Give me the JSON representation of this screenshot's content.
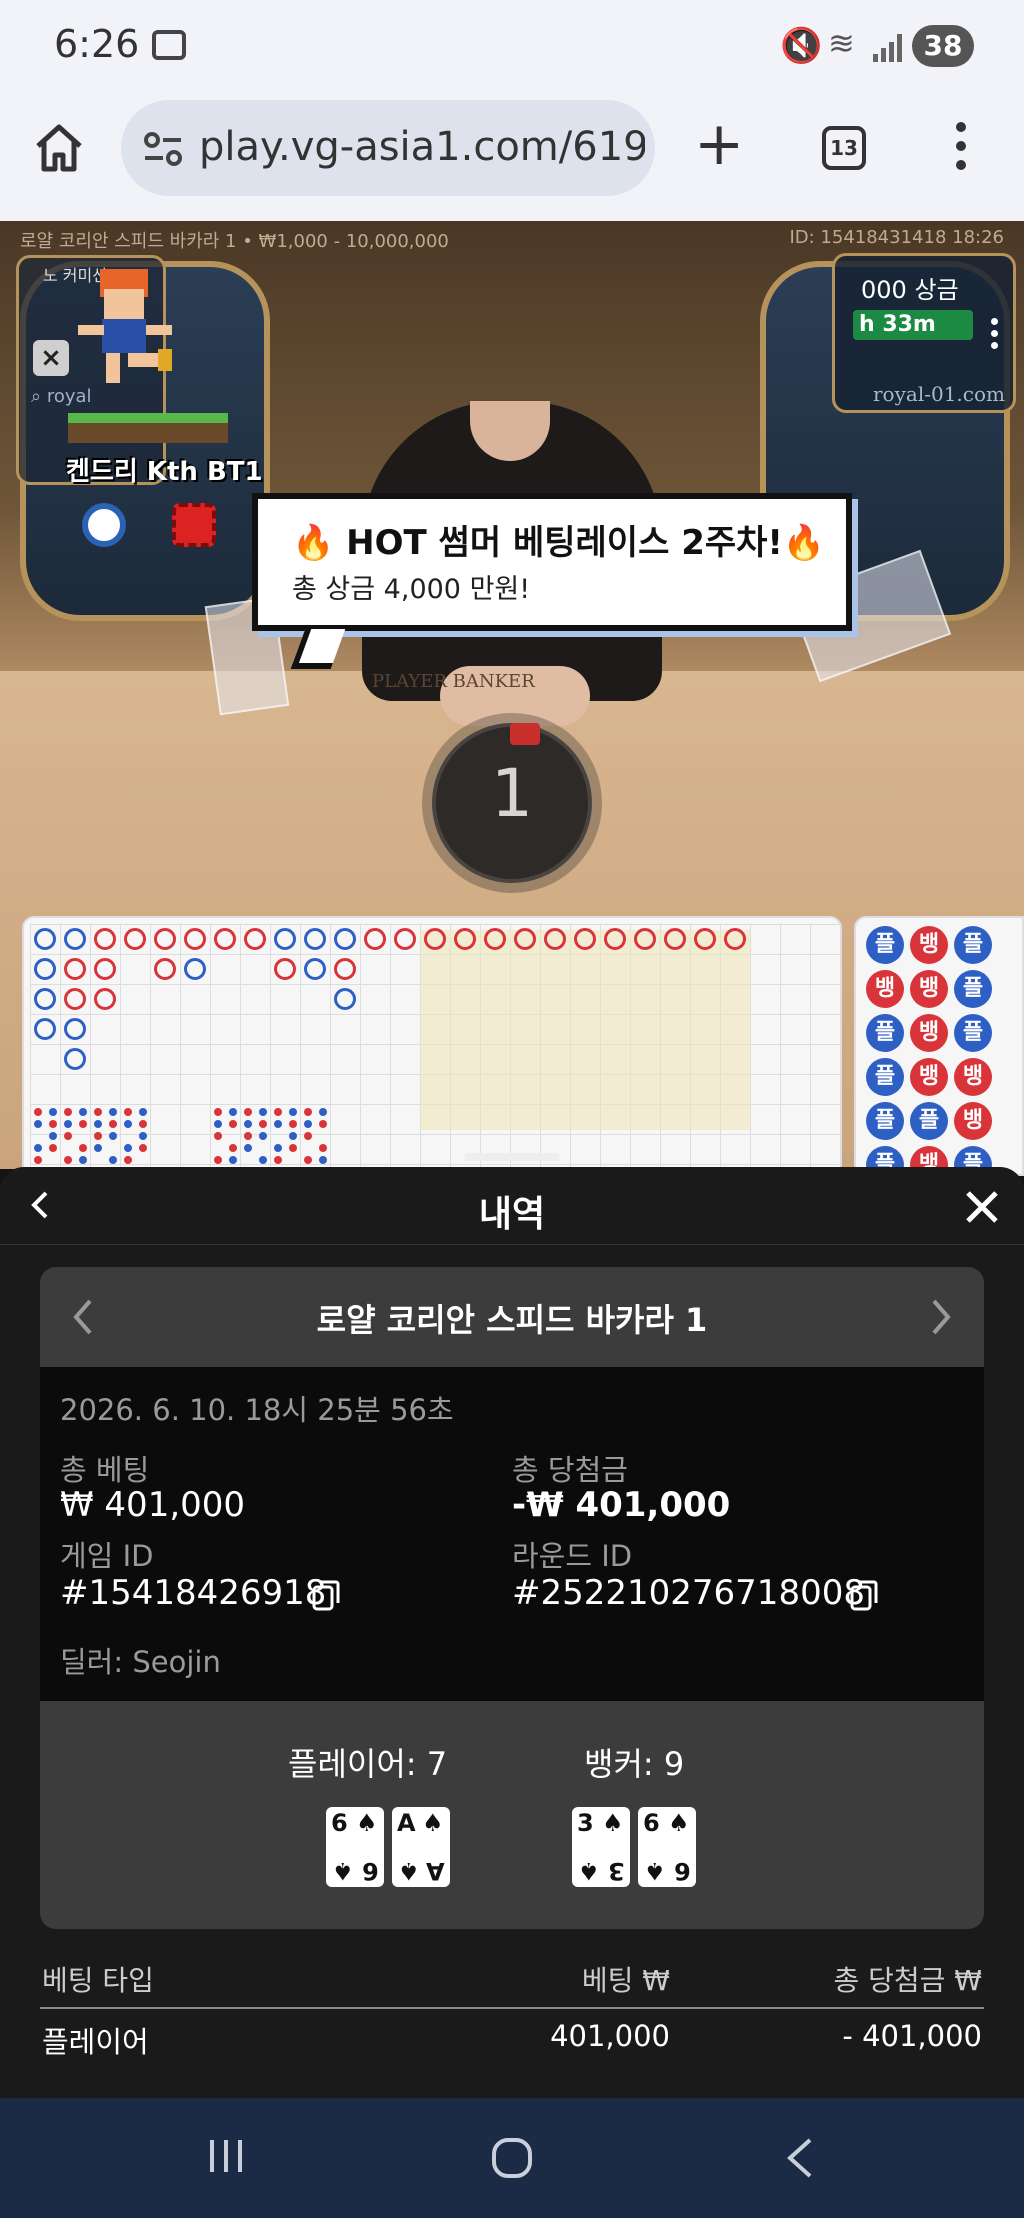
{
  "status_bar": {
    "time": "6:26",
    "battery": "38",
    "icons": [
      "screenshot-icon",
      "mute-icon",
      "wifi-icon",
      "signal-icon",
      "battery-icon"
    ]
  },
  "browser": {
    "url": "play.vg-asia1.com/619",
    "tab_count": "13"
  },
  "game": {
    "top_info": "로얄 코리안 스피드 바카라 1 • ₩1,000 - 10,000,000",
    "game_id_label": "ID: 15418431418 18:26",
    "widget_label": "노 커미션",
    "widget_search": "royal",
    "mascot_name": "켄드리 Kth BT1",
    "right_prize": "000 상금",
    "right_timer": "h 33m",
    "right_site": "royal-01.com",
    "table_text": "PLAYER  BANKER",
    "countdown": "1",
    "promo_title": "🔥 HOT 썸머 베팅레이스 2주차!🔥",
    "promo_sub": "총 상금 4,000 만원!",
    "bead_labels": {
      "player": "플",
      "banker": "뱅"
    }
  },
  "panel": {
    "title": "내역",
    "game_name": "로얄 코리안 스피드 바카라 1",
    "datetime": "2026. 6. 10. 18시 25분 56초",
    "total_bet_label": "총 베팅",
    "total_bet_value": "₩ 401,000",
    "total_win_label": "총 당첨금",
    "total_win_value": "-₩ 401,000",
    "game_id_label": "게임 ID",
    "game_id_value": "#15418426918",
    "round_id_label": "라운드 ID",
    "round_id_value": "#252210276718008",
    "dealer": "딜러: Seojin",
    "player_result": "플레이어: 7",
    "banker_result": "뱅커: 9",
    "player_cards": [
      {
        "rank": "6",
        "suit": "♠"
      },
      {
        "rank": "A",
        "suit": "♠"
      }
    ],
    "banker_cards": [
      {
        "rank": "3",
        "suit": "♠"
      },
      {
        "rank": "6",
        "suit": "♠"
      }
    ],
    "table": {
      "headers": [
        "베팅 타입",
        "베팅 ₩",
        "총 당첨금 ₩"
      ],
      "rows": [
        {
          "type": "플레이어",
          "bet": "401,000",
          "win": "- 401,000"
        }
      ]
    }
  },
  "colors": {
    "player_blue": "#2e5fc4",
    "banker_red": "#d8343a",
    "panel_bg": "#1a1a1a",
    "nav_bg": "#1c2b45"
  }
}
